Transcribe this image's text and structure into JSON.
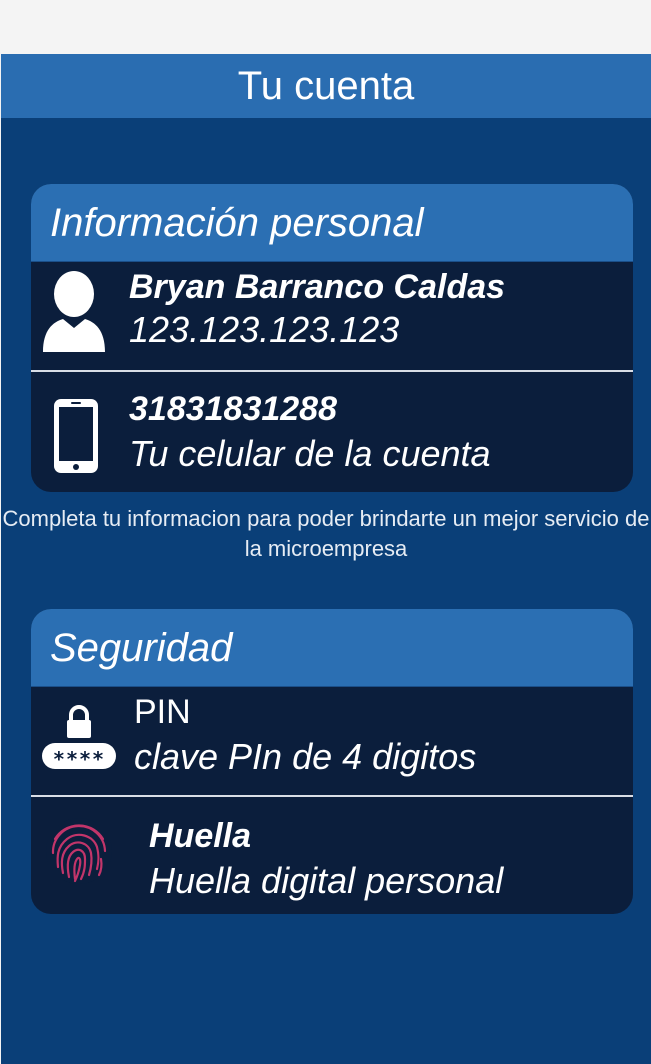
{
  "header": {
    "title": "Tu cuenta"
  },
  "personal": {
    "title": "Información personal",
    "user_name": "Bryan Barranco Caldas",
    "user_id": "123.123.123.123",
    "phone": "31831831288",
    "phone_desc": "Tu celular de la cuenta"
  },
  "note": "Completa tu informacion para poder brindarte un mejor servicio de la microempresa",
  "security": {
    "title": "Seguridad",
    "pin_label": "PIN",
    "pin_desc": "clave PIn de 4 digitos",
    "pin_mask": "****",
    "fingerprint_label": "Huella",
    "fingerprint_desc": "Huella digital personal"
  },
  "colors": {
    "background": "#0a3f78",
    "header": "#2a6db1",
    "card": "#0b1e3c",
    "fingerprint": "#c2356a"
  },
  "icons": [
    "user-icon",
    "phone-icon",
    "lock-pin-icon",
    "fingerprint-icon"
  ]
}
